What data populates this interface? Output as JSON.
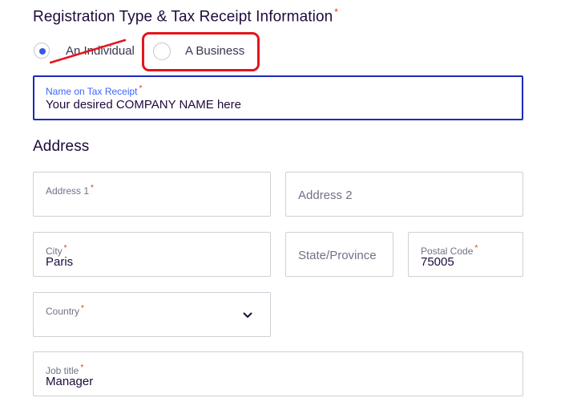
{
  "registration": {
    "title": "Registration Type & Tax Receipt Information",
    "required_mark": "*",
    "options": [
      {
        "label": "An Individual",
        "selected": true
      },
      {
        "label": "A Business",
        "selected": false
      }
    ]
  },
  "tax_receipt": {
    "label": "Name on Tax Receipt",
    "required_mark": "*",
    "value": "Your desired COMPANY NAME here"
  },
  "address": {
    "title": "Address",
    "address1": {
      "label": "Address 1",
      "required_mark": "*",
      "value": ""
    },
    "address2": {
      "placeholder": "Address 2"
    },
    "city": {
      "label": "City",
      "required_mark": "*",
      "value": "Paris"
    },
    "state": {
      "placeholder": "State/Province"
    },
    "postal": {
      "label": "Postal Code",
      "required_mark": "*",
      "value": "75005"
    },
    "country": {
      "label": "Country",
      "required_mark": "*",
      "value": ""
    },
    "job_title": {
      "label": "Job title",
      "required_mark": "*",
      "value": "Manager"
    }
  },
  "colors": {
    "accent": "#3659e3",
    "focus_border": "#1c2ab8",
    "required": "#d1410c",
    "annotation_red": "#e4141b"
  }
}
